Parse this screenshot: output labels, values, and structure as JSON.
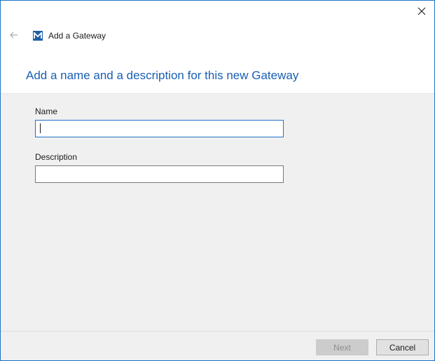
{
  "window": {
    "title": "Add a Gateway",
    "app_icon_letter": "M",
    "close_icon": "close-icon",
    "back_icon": "back-arrow-icon"
  },
  "heading": "Add a name and a description for this new Gateway",
  "form": {
    "name_label": "Name",
    "name_value": "",
    "description_label": "Description",
    "description_value": ""
  },
  "footer": {
    "next_label": "Next",
    "cancel_label": "Cancel"
  },
  "colors": {
    "accent": "#1a5fb4",
    "focus_border": "#1e73c8",
    "content_background": "#f0f0f0"
  }
}
